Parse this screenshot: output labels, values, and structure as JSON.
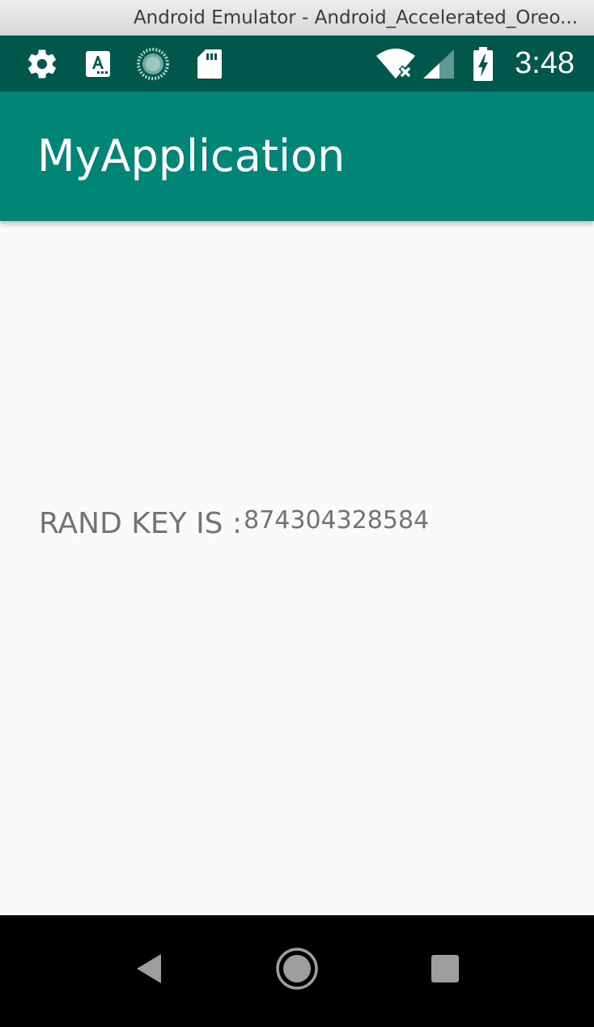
{
  "window": {
    "title": "Android Emulator - Android_Accelerated_Oreo..."
  },
  "status_bar": {
    "icons": [
      "gear-icon",
      "text-a-icon",
      "sync-circle-icon",
      "sd-card-icon",
      "wifi-off-icon",
      "signal-icon",
      "battery-charging-icon"
    ],
    "time": "3:48"
  },
  "app_bar": {
    "title": "MyApplication",
    "color": "#008577"
  },
  "content": {
    "label": "RAND KEY IS :",
    "value": "874304328584"
  },
  "nav_bar": {
    "buttons": [
      "back-icon",
      "home-icon",
      "recents-icon"
    ]
  },
  "colors": {
    "status_bar": "#00574b",
    "app_bar": "#008577",
    "background": "#fafafa",
    "text": "#737373"
  }
}
